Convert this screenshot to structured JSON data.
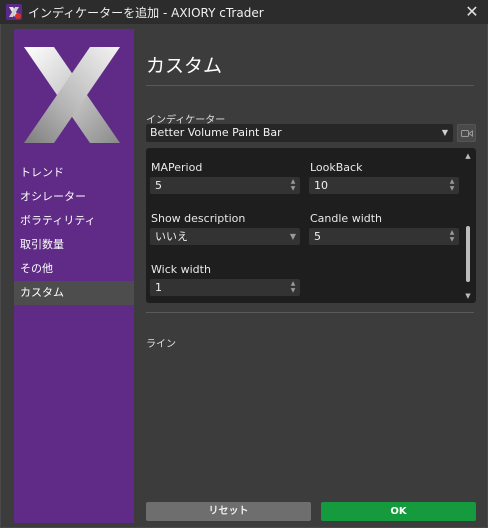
{
  "window": {
    "title": "インディケーターを追加 - AXIORY cTrader",
    "close_icon": "close-icon",
    "app_icon": "ctrader-app-icon"
  },
  "sidebar": {
    "logo": "axiory-x-logo",
    "items": [
      {
        "label": "トレンド",
        "active": false
      },
      {
        "label": "オシレーター",
        "active": false
      },
      {
        "label": "ボラティリティ",
        "active": false
      },
      {
        "label": "取引数量",
        "active": false
      },
      {
        "label": "その他",
        "active": false
      },
      {
        "label": "カスタム",
        "active": true
      }
    ]
  },
  "main": {
    "title": "カスタム",
    "indicator_label": "インディケーター",
    "indicator_value": "Better Volume Paint Bar",
    "video_icon": "video-camera-icon",
    "params": {
      "ma_period": {
        "label": "MAPeriod",
        "value": "5"
      },
      "lookback": {
        "label": "LookBack",
        "value": "10"
      },
      "show_description": {
        "label": "Show description",
        "value": "いいえ"
      },
      "candle_width": {
        "label": "Candle width",
        "value": "5"
      },
      "wick_width": {
        "label": "Wick width",
        "value": "1"
      }
    },
    "lines_label": "ライン",
    "reset_button": "リセット",
    "ok_button": "OK"
  },
  "colors": {
    "sidebar_bg": "#5f2b86",
    "ok_green": "#159a3e",
    "panel_bg": "#1e1e1e",
    "window_bg": "#3c3c3c"
  }
}
